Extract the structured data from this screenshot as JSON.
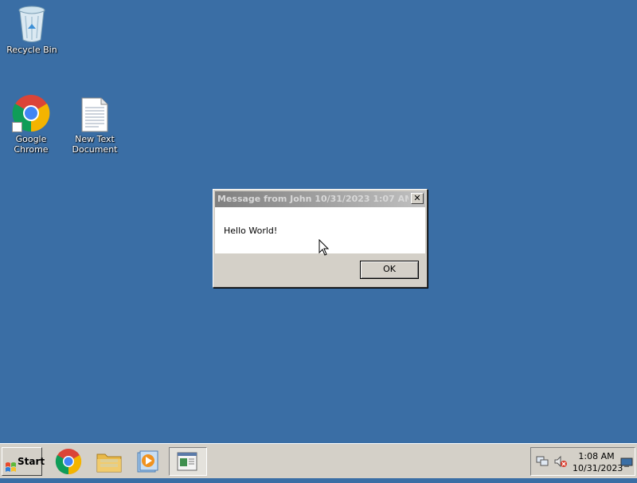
{
  "desktop": {
    "icons": [
      {
        "label": "Recycle Bin",
        "icon": "recycle-bin-icon"
      },
      {
        "label": "Google Chrome",
        "icon": "chrome-icon"
      },
      {
        "label": "New Text Document",
        "icon": "text-document-icon"
      }
    ],
    "background_color": "#3a6ea5"
  },
  "dialog": {
    "title": "Message from John 10/31/2023 1:07 AM",
    "message": "Hello World!",
    "ok_label": "OK",
    "close_label": "✕"
  },
  "taskbar": {
    "start_label": "Start",
    "pinned": [
      "chrome-icon",
      "file-explorer-icon",
      "media-player-icon",
      "message-window-icon"
    ],
    "tray": {
      "icons": [
        "network-icon",
        "volume-muted-icon",
        "show-desktop-icon"
      ],
      "time": "1:08 AM",
      "date": "10/31/2023"
    }
  }
}
